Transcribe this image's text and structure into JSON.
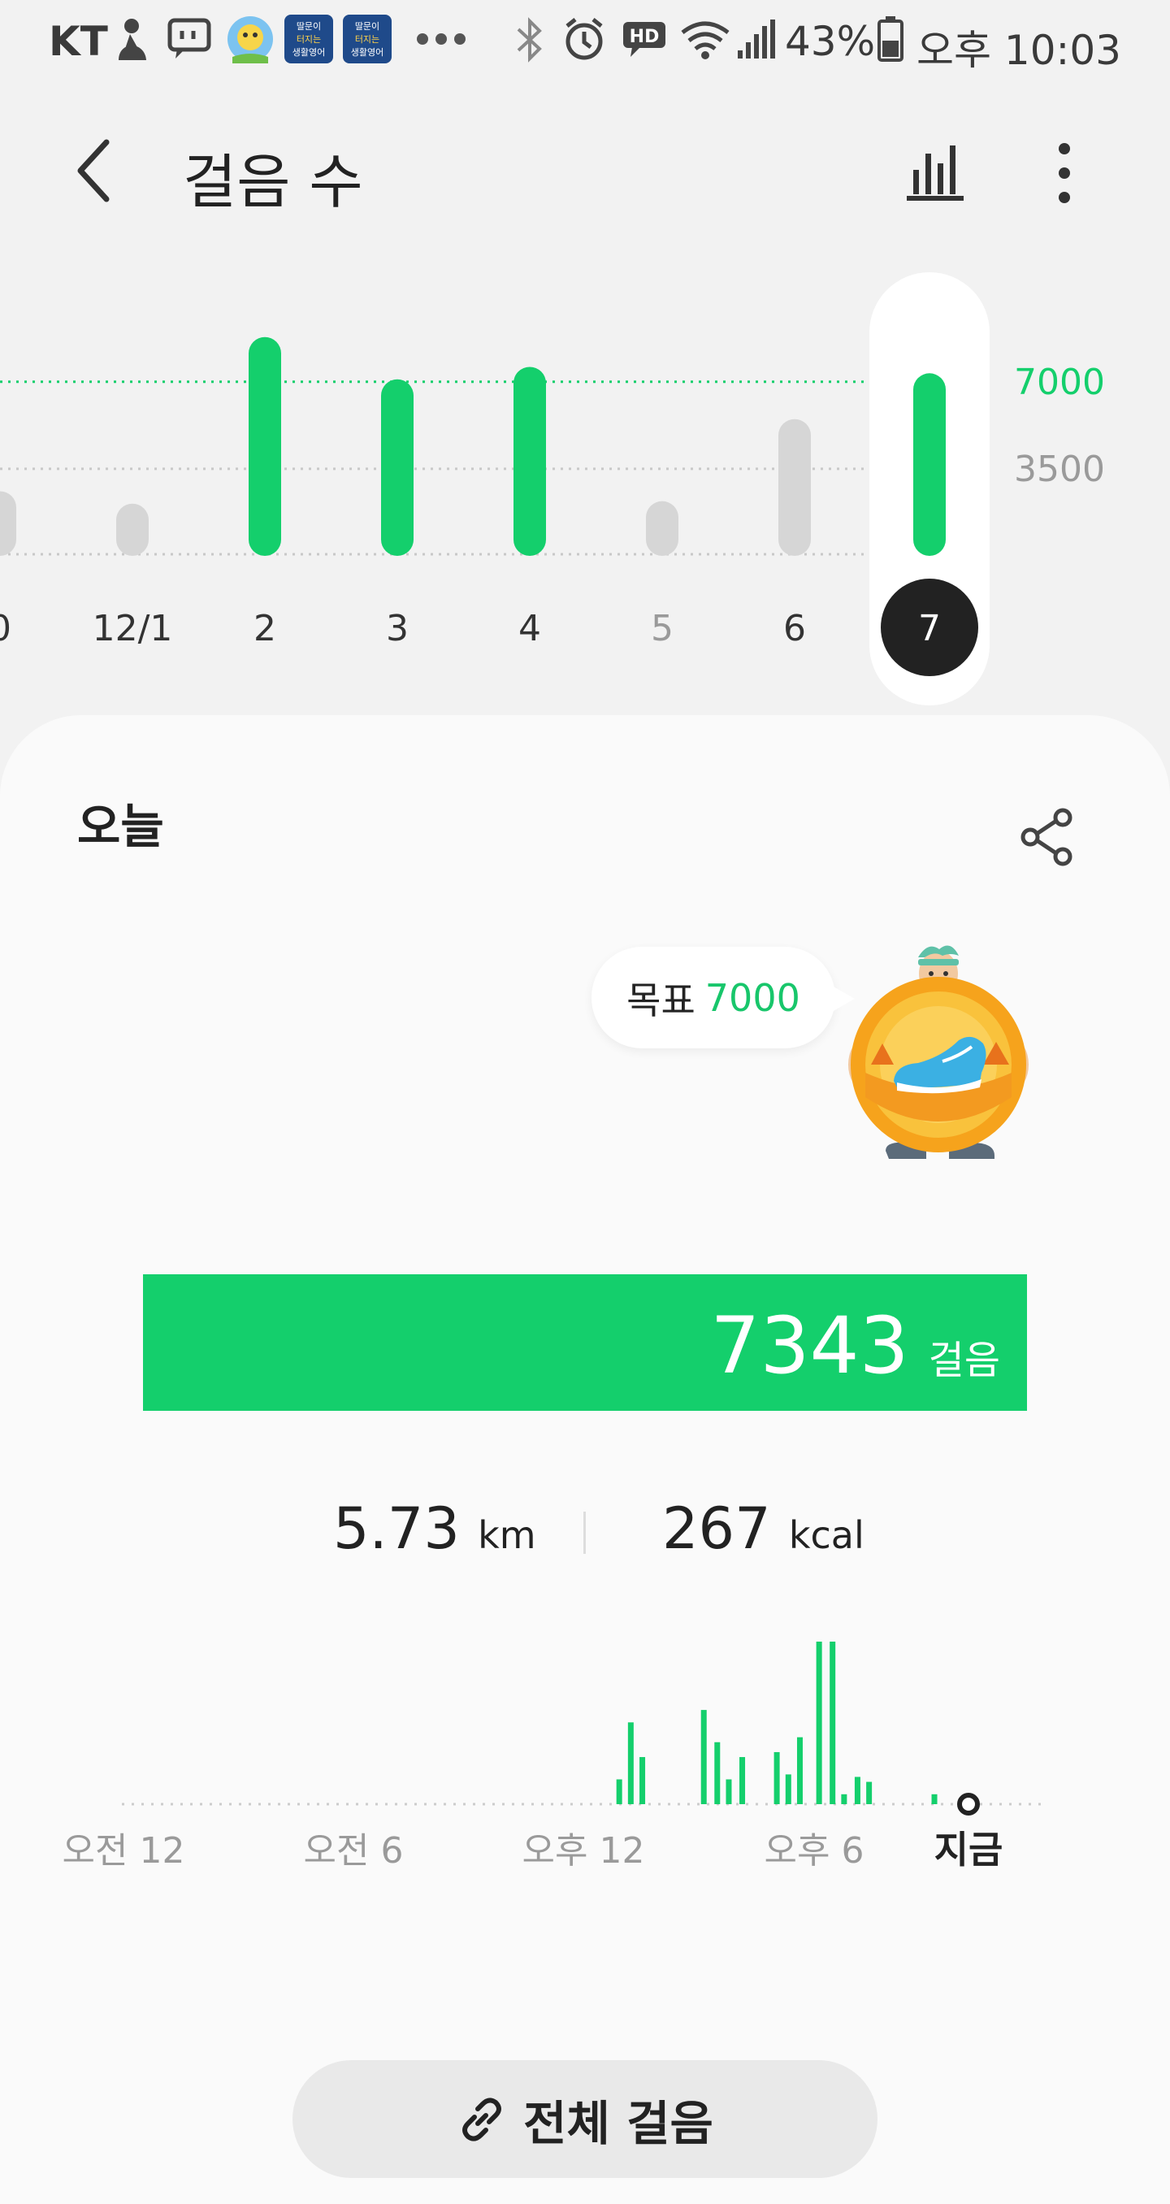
{
  "status_bar": {
    "carrier": "KT",
    "battery_percent": "43%",
    "time": "오후 10:03",
    "app_tile_text": [
      "딸문이",
      "터지는",
      "생활영어"
    ],
    "icons": [
      "person-icon",
      "chat-icon",
      "app-icon",
      "english-app-icon",
      "english-app-icon",
      "more-dots-icon",
      "bluetooth-icon",
      "alarm-icon",
      "hd-icon",
      "wifi-icon",
      "signal-icon",
      "battery-icon"
    ]
  },
  "header": {
    "title": "걸음 수",
    "icons": [
      "back-arrow-icon",
      "bar-chart-icon",
      "more-vert-icon"
    ]
  },
  "week_chart": {
    "goal_label": "7000",
    "half_goal_label": "3500",
    "days": [
      {
        "label": "0",
        "steps": 2600,
        "goal_met": false
      },
      {
        "label": "12/1",
        "steps": 2100,
        "goal_met": false
      },
      {
        "label": "2",
        "steps": 8800,
        "goal_met": true
      },
      {
        "label": "3",
        "steps": 7100,
        "goal_met": true
      },
      {
        "label": "4",
        "steps": 7600,
        "goal_met": true
      },
      {
        "label": "5",
        "steps": 2200,
        "goal_met": false
      },
      {
        "label": "6",
        "steps": 5500,
        "goal_met": false
      },
      {
        "label": "7",
        "steps": 7343,
        "goal_met": true,
        "selected": true
      }
    ],
    "colors": {
      "goal_met": "#14cf6c",
      "below_goal": "#d6d6d6",
      "goal_line": "#14cf6c",
      "selected_badge": "#222222"
    }
  },
  "today": {
    "label": "오늘",
    "goal_label": "목표",
    "goal_value": "7000",
    "steps": "7343",
    "steps_unit": "걸음",
    "distance_value": "5.73",
    "distance_unit": "km",
    "calories_value": "267",
    "calories_unit": "kcal"
  },
  "day_chart": {
    "x_labels": [
      "오전 12",
      "오전 6",
      "오후 12",
      "오후 6"
    ],
    "now_label": "지금",
    "bars": [
      {
        "hour": 12.9,
        "v": 0.1
      },
      {
        "hour": 13.2,
        "v": 0.33
      },
      {
        "hour": 13.5,
        "v": 0.19
      },
      {
        "hour": 15.1,
        "v": 0.38
      },
      {
        "hour": 15.45,
        "v": 0.25
      },
      {
        "hour": 15.75,
        "v": 0.1
      },
      {
        "hour": 16.1,
        "v": 0.19
      },
      {
        "hour": 17.0,
        "v": 0.21
      },
      {
        "hour": 17.3,
        "v": 0.12
      },
      {
        "hour": 17.6,
        "v": 0.27
      },
      {
        "hour": 18.1,
        "v": 0.8
      },
      {
        "hour": 18.45,
        "v": 1.0
      },
      {
        "hour": 18.75,
        "v": 0.04
      },
      {
        "hour": 19.1,
        "v": 0.11
      },
      {
        "hour": 19.4,
        "v": 0.09
      },
      {
        "hour": 21.1,
        "v": 0.04
      }
    ],
    "color": "#14cf6c"
  },
  "all_steps_button": {
    "label": "전체 걸음",
    "icon": "link-icon"
  },
  "share_icon": "share-icon"
}
